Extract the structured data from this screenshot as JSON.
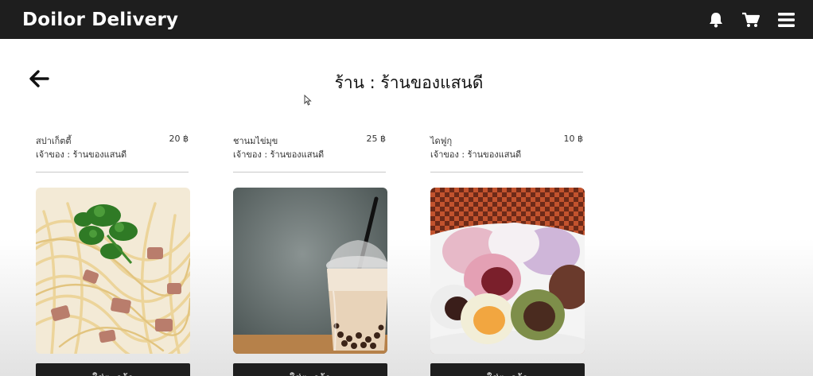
{
  "header": {
    "brand": "Doilor Delivery",
    "icons": [
      "bell-icon",
      "cart-icon",
      "menu-icon"
    ]
  },
  "store": {
    "title": "ร้าน : ร้านของแสนดี"
  },
  "products": [
    {
      "name": "สปาเก็ตตี้",
      "price": "20 ฿",
      "owner": "เจ้าของ : ร้านของแสนดี",
      "button": "ใส่ตะกร้า",
      "image": "spaghetti"
    },
    {
      "name": "ชานมไข่มุข",
      "price": "25 ฿",
      "owner": "เจ้าของ : ร้านของแสนดี",
      "button": "ใส่ตะกร้า",
      "image": "bubble-milk-tea"
    },
    {
      "name": "ไดฟูกุ",
      "price": "10 ฿",
      "owner": "เจ้าของ : ร้านของแสนดี",
      "button": "ใส่ตะกร้า",
      "image": "daifuku"
    }
  ],
  "colors": {
    "navbar": "#1e1e1e",
    "button": "#1e1e1e"
  }
}
